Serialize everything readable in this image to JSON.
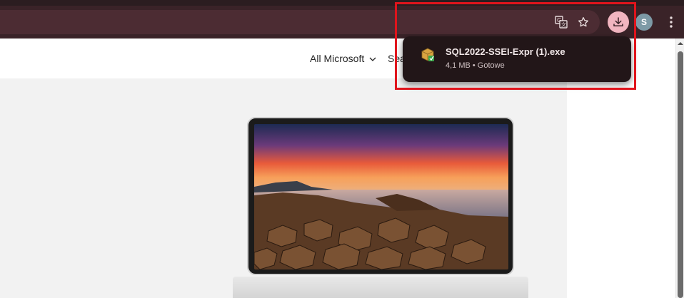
{
  "toolbar": {
    "translate_icon": "translate-icon",
    "bookmark_icon": "star-icon",
    "downloads_icon": "download-icon",
    "profile_initial": "S",
    "menu_icon": "kebab-menu-icon"
  },
  "nav": {
    "all_microsoft": "All Microsoft",
    "search_partial": "Search"
  },
  "downloads_popup": {
    "file_name": "SQL2022-SSEI-Expr (1).exe",
    "status": "4,1 MB • Gotowe",
    "file_icon": "installer-package-icon"
  },
  "colors": {
    "toolbar_bg": "#3a2328",
    "omnibox_bg": "#4c2c33",
    "downloads_active": "#f2b5c0",
    "popup_bg": "#221618",
    "highlight": "#e0141c"
  }
}
